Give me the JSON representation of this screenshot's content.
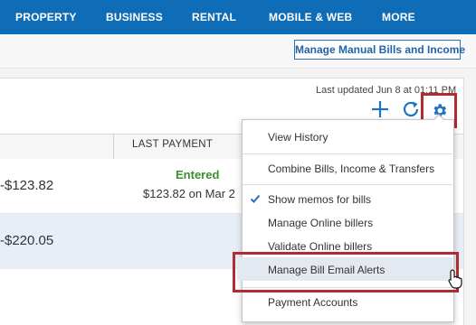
{
  "nav": {
    "items": [
      "PROPERTY",
      "BUSINESS",
      "RENTAL",
      "MOBILE & WEB",
      "MORE"
    ]
  },
  "toolbar": {
    "manage_manual_label": "Manage Manual Bills and Income",
    "last_updated": "Last updated Jun 8 at 01:11 PM"
  },
  "table": {
    "header_last_payment": "LAST PAYMENT",
    "rows": [
      {
        "amount": "-$123.82",
        "status": "Entered",
        "last_payment": "$123.82 on Mar 2"
      },
      {
        "amount": "-$220.05"
      }
    ]
  },
  "menu": {
    "items": [
      "View History",
      "Combine Bills, Income & Transfers",
      "Show memos for bills",
      "Manage Online billers",
      "Validate Online billers",
      "Manage Bill Email Alerts",
      "Payment Accounts"
    ]
  },
  "colors": {
    "nav_bg": "#0f6cb6",
    "accent": "#1f74c2",
    "status_green": "#3b8f2b",
    "highlight_outline": "#b22b33",
    "selected_row": "#e7eef7"
  },
  "icons": {
    "add": "plus-icon",
    "refresh": "refresh-icon",
    "settings": "gear-icon",
    "check": "check-icon",
    "cursor": "pointer-cursor-icon"
  }
}
